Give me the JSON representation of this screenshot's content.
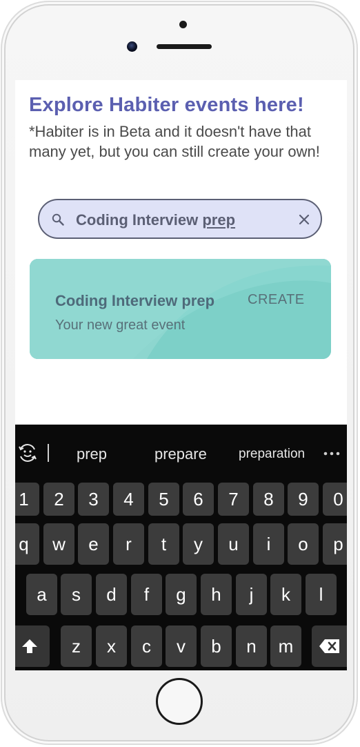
{
  "app": {
    "title": "Explore Habiter events here!",
    "subtitle": "*Habiter is in Beta and it doesn't have that many yet, but you can still create your own!"
  },
  "search": {
    "value_prefix": "Coding Interview ",
    "value_underlined": "prep",
    "icon": "search-icon",
    "clear_icon": "close-icon"
  },
  "card": {
    "title": "Coding Interview prep",
    "subtitle": "Your new great event",
    "action_label": "CREATE"
  },
  "keyboard": {
    "suggestions": [
      "prep",
      "prepare",
      "preparation"
    ],
    "number_row": [
      "1",
      "2",
      "3",
      "4",
      "5",
      "6",
      "7",
      "8",
      "9",
      "0"
    ],
    "row1": [
      "q",
      "w",
      "e",
      "r",
      "t",
      "y",
      "u",
      "i",
      "o",
      "p"
    ],
    "row2": [
      "a",
      "s",
      "d",
      "f",
      "g",
      "h",
      "j",
      "k",
      "l"
    ],
    "row3": [
      "z",
      "x",
      "c",
      "v",
      "b",
      "n",
      "m"
    ],
    "shift_icon": "shift-arrow-icon",
    "backspace_icon": "backspace-icon",
    "emoji_icon": "emoji-icon",
    "more_icon": "more-dots-icon"
  },
  "colors": {
    "title": "#5b5fb0",
    "card": "#7dd0c8",
    "search_bg": "#dfe2f7",
    "keyboard_bg": "#0a0a0a"
  }
}
